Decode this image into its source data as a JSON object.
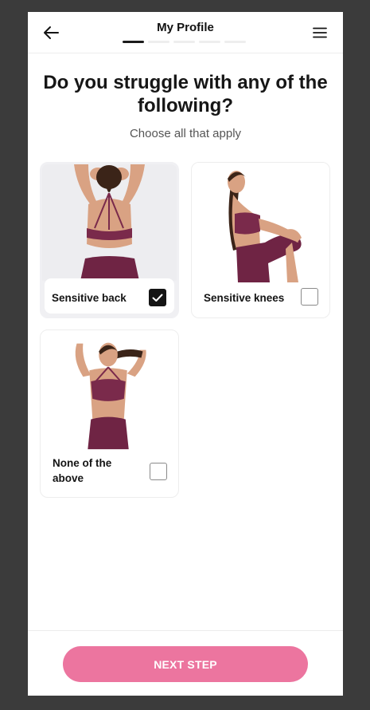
{
  "header": {
    "title": "My Profile",
    "progress_total": 5,
    "progress_current": 1,
    "back_icon": "arrow-left-icon",
    "menu_icon": "hamburger-menu-icon"
  },
  "question": {
    "title": "Do you struggle with any of the following?",
    "subtitle": "Choose all that apply"
  },
  "options": [
    {
      "label": "Sensitive back",
      "checked": true,
      "image": "woman-back-view-photo"
    },
    {
      "label": "Sensitive knees",
      "checked": false,
      "image": "woman-knee-stretch-photo"
    },
    {
      "label": "None of the above",
      "checked": false,
      "image": "woman-front-pose-photo"
    }
  ],
  "footer": {
    "next_label": "NEXT STEP"
  },
  "colors": {
    "accent": "#ec759f",
    "outfit": "#7a2a4b",
    "skin": "#d9a283",
    "selected_bg": "#f0f0f3"
  }
}
